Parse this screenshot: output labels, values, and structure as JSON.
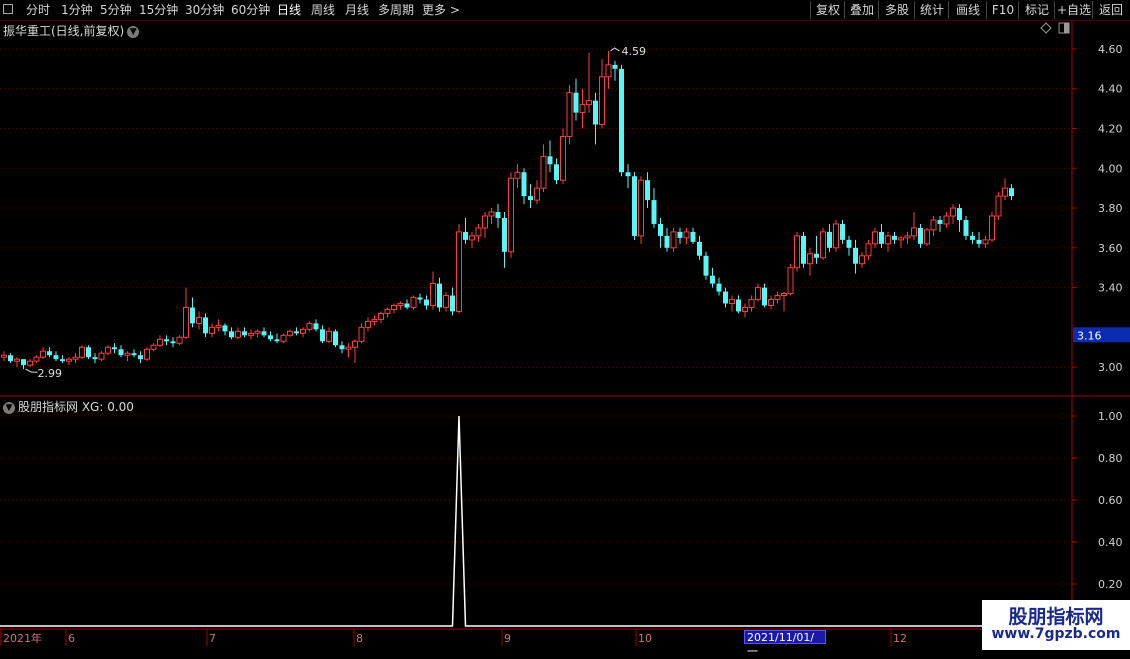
{
  "toolbar": {
    "periods": [
      {
        "label": "分时",
        "active": false
      },
      {
        "label": "1分钟",
        "active": false
      },
      {
        "label": "5分钟",
        "active": false
      },
      {
        "label": "15分钟",
        "active": false
      },
      {
        "label": "30分钟",
        "active": false
      },
      {
        "label": "60分钟",
        "active": false
      },
      {
        "label": "日线",
        "active": true
      },
      {
        "label": "周线",
        "active": false
      },
      {
        "label": "月线",
        "active": false
      },
      {
        "label": "多周期",
        "active": false
      },
      {
        "label": "更多",
        "active": false
      }
    ],
    "right_buttons": [
      "复权",
      "叠加",
      "多股",
      "统计",
      "画线",
      "F10",
      "标记",
      "+自选",
      "返回"
    ]
  },
  "chart_title": "振华重工(日线,前复权)",
  "colors": {
    "up": "#ff3d3d",
    "down": "#55f7f7",
    "grid": "#5a0000",
    "axis": "#aa0000",
    "indicator_line": "#ffffff"
  },
  "price_axis": {
    "ticks": [
      "4.60",
      "4.40",
      "4.20",
      "4.00",
      "3.80",
      "3.60",
      "3.40",
      "3.00"
    ],
    "current_price_label": "3.16"
  },
  "annotations": {
    "high_label": "4.59",
    "low_label": "2.99"
  },
  "indicator": {
    "title": "股朋指标网 XG: 0.00",
    "ticks": [
      "1.00",
      "0.80",
      "0.60",
      "0.40",
      "0.20"
    ]
  },
  "time_axis": {
    "labels": [
      "2021年",
      "6",
      "7",
      "8",
      "9",
      "10",
      "11",
      "12"
    ],
    "selected_date": "2021/11/01/一"
  },
  "watermark": {
    "line1": "股朋指标网",
    "line2": "www.7gpzb.com"
  },
  "chart_data": {
    "type": "candlestick",
    "ohlc": [
      [
        3.05,
        3.08,
        3.03,
        3.06
      ],
      [
        3.06,
        3.07,
        3.02,
        3.03
      ],
      [
        3.03,
        3.05,
        3.0,
        3.04
      ],
      [
        3.04,
        3.04,
        2.99,
        3.01
      ],
      [
        3.01,
        3.04,
        3.0,
        3.03
      ],
      [
        3.03,
        3.06,
        3.02,
        3.05
      ],
      [
        3.05,
        3.1,
        3.04,
        3.08
      ],
      [
        3.08,
        3.1,
        3.05,
        3.06
      ],
      [
        3.06,
        3.08,
        3.03,
        3.04
      ],
      [
        3.04,
        3.06,
        3.02,
        3.03
      ],
      [
        3.03,
        3.05,
        3.01,
        3.04
      ],
      [
        3.04,
        3.07,
        3.02,
        3.05
      ],
      [
        3.05,
        3.11,
        3.04,
        3.1
      ],
      [
        3.1,
        3.11,
        3.04,
        3.05
      ],
      [
        3.05,
        3.07,
        3.02,
        3.04
      ],
      [
        3.04,
        3.08,
        3.03,
        3.07
      ],
      [
        3.07,
        3.11,
        3.06,
        3.1
      ],
      [
        3.1,
        3.12,
        3.07,
        3.09
      ],
      [
        3.09,
        3.11,
        3.05,
        3.06
      ],
      [
        3.06,
        3.08,
        3.03,
        3.07
      ],
      [
        3.07,
        3.09,
        3.05,
        3.06
      ],
      [
        3.06,
        3.08,
        3.02,
        3.04
      ],
      [
        3.04,
        3.1,
        3.03,
        3.09
      ],
      [
        3.09,
        3.12,
        3.08,
        3.11
      ],
      [
        3.11,
        3.16,
        3.1,
        3.14
      ],
      [
        3.14,
        3.16,
        3.11,
        3.13
      ],
      [
        3.13,
        3.15,
        3.1,
        3.12
      ],
      [
        3.12,
        3.16,
        3.11,
        3.15
      ],
      [
        3.15,
        3.4,
        3.14,
        3.3
      ],
      [
        3.3,
        3.35,
        3.2,
        3.22
      ],
      [
        3.22,
        3.28,
        3.19,
        3.25
      ],
      [
        3.25,
        3.27,
        3.15,
        3.17
      ],
      [
        3.17,
        3.22,
        3.15,
        3.2
      ],
      [
        3.2,
        3.24,
        3.18,
        3.21
      ],
      [
        3.21,
        3.22,
        3.16,
        3.18
      ],
      [
        3.18,
        3.2,
        3.14,
        3.15
      ],
      [
        3.15,
        3.2,
        3.14,
        3.18
      ],
      [
        3.18,
        3.2,
        3.15,
        3.16
      ],
      [
        3.16,
        3.19,
        3.14,
        3.17
      ],
      [
        3.17,
        3.19,
        3.15,
        3.18
      ],
      [
        3.18,
        3.2,
        3.15,
        3.16
      ],
      [
        3.16,
        3.18,
        3.13,
        3.14
      ],
      [
        3.14,
        3.17,
        3.12,
        3.13
      ],
      [
        3.13,
        3.17,
        3.12,
        3.16
      ],
      [
        3.16,
        3.19,
        3.15,
        3.18
      ],
      [
        3.18,
        3.2,
        3.16,
        3.17
      ],
      [
        3.17,
        3.2,
        3.15,
        3.19
      ],
      [
        3.19,
        3.23,
        3.18,
        3.22
      ],
      [
        3.22,
        3.24,
        3.18,
        3.19
      ],
      [
        3.19,
        3.21,
        3.12,
        3.13
      ],
      [
        3.13,
        3.2,
        3.12,
        3.18
      ],
      [
        3.18,
        3.19,
        3.1,
        3.11
      ],
      [
        3.11,
        3.13,
        3.07,
        3.09
      ],
      [
        3.09,
        3.12,
        3.05,
        3.1
      ],
      [
        3.1,
        3.14,
        3.02,
        3.13
      ],
      [
        3.13,
        3.22,
        3.12,
        3.2
      ],
      [
        3.2,
        3.25,
        3.18,
        3.23
      ],
      [
        3.23,
        3.26,
        3.21,
        3.24
      ],
      [
        3.24,
        3.28,
        3.22,
        3.27
      ],
      [
        3.27,
        3.3,
        3.25,
        3.29
      ],
      [
        3.29,
        3.32,
        3.27,
        3.31
      ],
      [
        3.31,
        3.33,
        3.29,
        3.32
      ],
      [
        3.32,
        3.34,
        3.29,
        3.3
      ],
      [
        3.3,
        3.36,
        3.29,
        3.35
      ],
      [
        3.35,
        3.37,
        3.32,
        3.34
      ],
      [
        3.34,
        3.36,
        3.29,
        3.31
      ],
      [
        3.31,
        3.48,
        3.29,
        3.42
      ],
      [
        3.42,
        3.45,
        3.28,
        3.3
      ],
      [
        3.3,
        3.38,
        3.28,
        3.36
      ],
      [
        3.36,
        3.4,
        3.26,
        3.28
      ],
      [
        3.28,
        3.72,
        3.27,
        3.68
      ],
      [
        3.68,
        3.75,
        3.62,
        3.64
      ],
      [
        3.64,
        3.68,
        3.6,
        3.66
      ],
      [
        3.66,
        3.72,
        3.63,
        3.7
      ],
      [
        3.7,
        3.78,
        3.65,
        3.76
      ],
      [
        3.76,
        3.8,
        3.72,
        3.78
      ],
      [
        3.78,
        3.82,
        3.7,
        3.75
      ],
      [
        3.75,
        3.78,
        3.5,
        3.58
      ],
      [
        3.58,
        3.98,
        3.55,
        3.95
      ],
      [
        3.95,
        4.02,
        3.9,
        3.98
      ],
      [
        3.98,
        4.0,
        3.82,
        3.86
      ],
      [
        3.86,
        3.92,
        3.8,
        3.84
      ],
      [
        3.84,
        3.94,
        3.82,
        3.9
      ],
      [
        3.9,
        4.12,
        3.88,
        4.06
      ],
      [
        4.06,
        4.14,
        3.98,
        4.02
      ],
      [
        4.02,
        4.05,
        3.92,
        3.94
      ],
      [
        3.94,
        4.2,
        3.92,
        4.16
      ],
      [
        4.16,
        4.42,
        4.12,
        4.38
      ],
      [
        4.38,
        4.45,
        4.24,
        4.28
      ],
      [
        4.28,
        4.4,
        4.2,
        4.32
      ],
      [
        4.32,
        4.58,
        4.28,
        4.34
      ],
      [
        4.34,
        4.38,
        4.12,
        4.22
      ],
      [
        4.22,
        4.55,
        4.2,
        4.46
      ],
      [
        4.46,
        4.59,
        4.4,
        4.52
      ],
      [
        4.52,
        4.54,
        4.44,
        4.5
      ],
      [
        4.5,
        4.52,
        3.96,
        3.98
      ],
      [
        3.98,
        4.02,
        3.9,
        3.96
      ],
      [
        3.96,
        3.98,
        3.64,
        3.66
      ],
      [
        3.66,
        3.96,
        3.62,
        3.94
      ],
      [
        3.94,
        3.98,
        3.8,
        3.84
      ],
      [
        3.84,
        3.9,
        3.7,
        3.72
      ],
      [
        3.72,
        3.75,
        3.6,
        3.66
      ],
      [
        3.66,
        3.7,
        3.58,
        3.6
      ],
      [
        3.6,
        3.7,
        3.58,
        3.68
      ],
      [
        3.68,
        3.7,
        3.62,
        3.65
      ],
      [
        3.65,
        3.7,
        3.62,
        3.68
      ],
      [
        3.68,
        3.7,
        3.62,
        3.63
      ],
      [
        3.63,
        3.66,
        3.54,
        3.56
      ],
      [
        3.56,
        3.58,
        3.44,
        3.46
      ],
      [
        3.46,
        3.5,
        3.4,
        3.42
      ],
      [
        3.42,
        3.45,
        3.36,
        3.38
      ],
      [
        3.38,
        3.4,
        3.3,
        3.32
      ],
      [
        3.32,
        3.36,
        3.28,
        3.34
      ],
      [
        3.34,
        3.36,
        3.27,
        3.28
      ],
      [
        3.28,
        3.32,
        3.25,
        3.3
      ],
      [
        3.3,
        3.36,
        3.28,
        3.34
      ],
      [
        3.34,
        3.42,
        3.33,
        3.4
      ],
      [
        3.4,
        3.42,
        3.3,
        3.31
      ],
      [
        3.31,
        3.36,
        3.29,
        3.34
      ],
      [
        3.34,
        3.38,
        3.32,
        3.36
      ],
      [
        3.36,
        3.38,
        3.28,
        3.37
      ],
      [
        3.37,
        3.52,
        3.36,
        3.5
      ],
      [
        3.5,
        3.68,
        3.48,
        3.66
      ],
      [
        3.66,
        3.68,
        3.5,
        3.52
      ],
      [
        3.52,
        3.6,
        3.46,
        3.57
      ],
      [
        3.57,
        3.66,
        3.52,
        3.55
      ],
      [
        3.55,
        3.7,
        3.54,
        3.68
      ],
      [
        3.68,
        3.72,
        3.58,
        3.6
      ],
      [
        3.6,
        3.74,
        3.58,
        3.72
      ],
      [
        3.72,
        3.74,
        3.62,
        3.64
      ],
      [
        3.64,
        3.66,
        3.56,
        3.6
      ],
      [
        3.6,
        3.64,
        3.47,
        3.52
      ],
      [
        3.52,
        3.58,
        3.5,
        3.56
      ],
      [
        3.56,
        3.64,
        3.54,
        3.62
      ],
      [
        3.62,
        3.7,
        3.6,
        3.68
      ],
      [
        3.68,
        3.72,
        3.6,
        3.62
      ],
      [
        3.62,
        3.68,
        3.58,
        3.66
      ],
      [
        3.66,
        3.68,
        3.62,
        3.64
      ],
      [
        3.64,
        3.66,
        3.6,
        3.65
      ],
      [
        3.65,
        3.68,
        3.62,
        3.66
      ],
      [
        3.66,
        3.78,
        3.64,
        3.7
      ],
      [
        3.7,
        3.72,
        3.6,
        3.62
      ],
      [
        3.62,
        3.7,
        3.61,
        3.69
      ],
      [
        3.69,
        3.76,
        3.66,
        3.74
      ],
      [
        3.74,
        3.76,
        3.68,
        3.72
      ],
      [
        3.72,
        3.78,
        3.7,
        3.76
      ],
      [
        3.76,
        3.82,
        3.72,
        3.8
      ],
      [
        3.8,
        3.82,
        3.68,
        3.74
      ],
      [
        3.74,
        3.76,
        3.64,
        3.66
      ],
      [
        3.66,
        3.68,
        3.62,
        3.64
      ],
      [
        3.64,
        3.68,
        3.6,
        3.62
      ],
      [
        3.62,
        3.66,
        3.6,
        3.64
      ],
      [
        3.64,
        3.78,
        3.63,
        3.76
      ],
      [
        3.76,
        3.88,
        3.74,
        3.86
      ],
      [
        3.86,
        3.95,
        3.84,
        3.9
      ],
      [
        3.9,
        3.92,
        3.84,
        3.86
      ]
    ],
    "indicator_XG": {
      "name": "XG",
      "spike_index": 70,
      "spike_value": 1.0,
      "baseline": 0.0
    },
    "y_range": [
      2.88,
      4.64
    ],
    "indicator_range": [
      0,
      1.0
    ]
  }
}
